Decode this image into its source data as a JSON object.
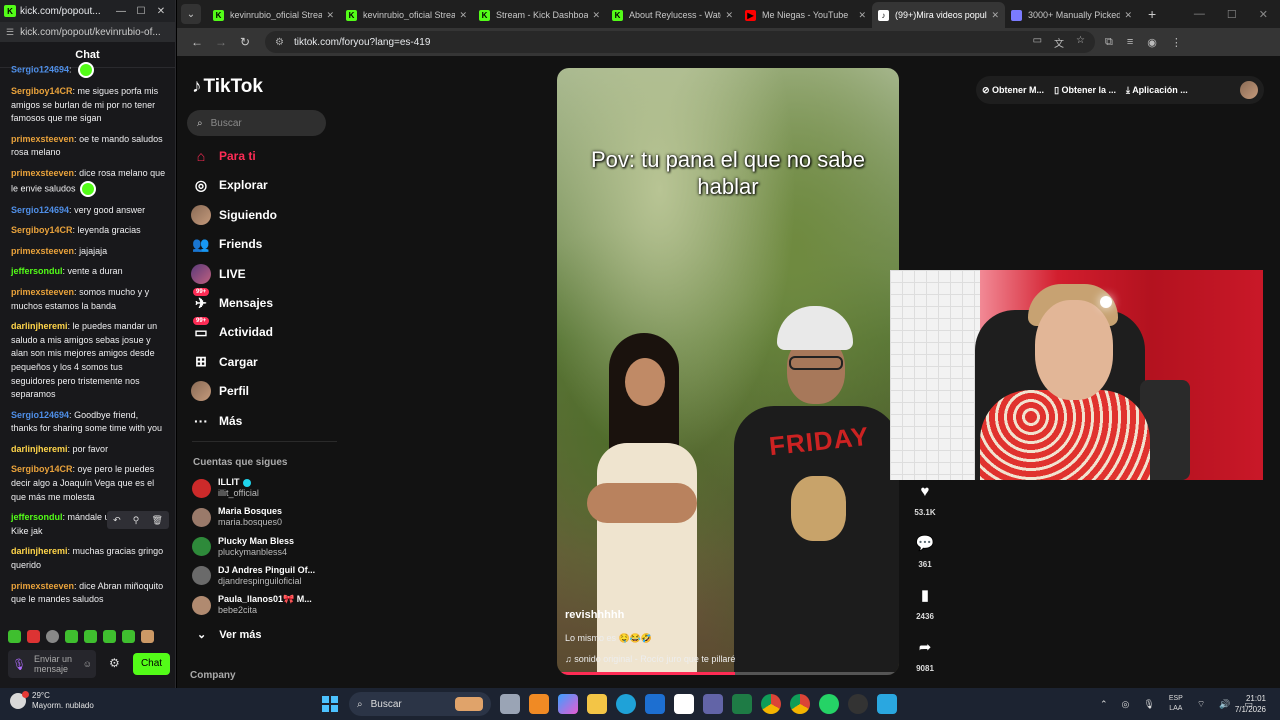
{
  "chat_window": {
    "title": "kick.com/popout...",
    "url": "kick.com/popout/kevinrubio-of...",
    "header": "Chat",
    "messages": [
      {
        "user": "Sergio124694",
        "text": "",
        "color": "blue",
        "emote": true
      },
      {
        "user": "Sergiboy14CR",
        "text": "me sigues porfa mis amigos se burlan de mi por no tener famosos que me sigan",
        "color": "orange"
      },
      {
        "user": "primexsteeven",
        "text": "oe te mando saludos rosa melano",
        "color": "orange"
      },
      {
        "user": "primexsteeven",
        "text": "dice rosa melano que le envie saludos",
        "color": "orange",
        "emote": true
      },
      {
        "user": "Sergio124694",
        "text": "very good answer",
        "color": "blue"
      },
      {
        "user": "Sergiboy14CR",
        "text": "leyenda gracias",
        "color": "orange"
      },
      {
        "user": "primexsteeven",
        "text": "jajajaja",
        "color": "orange"
      },
      {
        "user": "jeffersondul",
        "text": "vente a duran",
        "color": "green"
      },
      {
        "user": "primexsteeven",
        "text": "somos mucho y y muchos estamos la banda",
        "color": "orange"
      },
      {
        "user": "darlinjheremi",
        "text": "le puedes mandar un saludo a mis amigos sebas josue y alan son mis mejores amigos desde pequeños y los 4 somos tus seguidores pero tristemente nos separamos",
        "color": "yellow"
      },
      {
        "user": "Sergio124694",
        "text": "Goodbye friend, thanks for sharing some time with you",
        "color": "blue"
      },
      {
        "user": "darlinjheremi",
        "text": "por favor",
        "color": "yellow"
      },
      {
        "user": "Sergiboy14CR",
        "text": "oye pero le puedes decir algo a Joaquín Vega que es el que más me molesta",
        "color": "orange"
      },
      {
        "user": "jeffersondul",
        "text": "mándale un saludo a Kike jak",
        "color": "green"
      },
      {
        "user": "darlinjheremi",
        "text": "muchas gracias gringo querido",
        "color": "yellow"
      },
      {
        "user": "primexsteeven",
        "text": "dice Abran miñoquito que le mandes saludos",
        "color": "orange"
      }
    ],
    "input_placeholder": "Enviar un mensaje",
    "send_label": "Chat"
  },
  "browser": {
    "tabs": [
      {
        "title": "kevinrubio_oficial Stream",
        "icon": "kick",
        "active": false
      },
      {
        "title": "kevinrubio_oficial Stream",
        "icon": "kick",
        "active": false
      },
      {
        "title": "Stream - Kick Dashboard",
        "icon": "kick",
        "active": false
      },
      {
        "title": "About Reylucess - Watch",
        "icon": "kick",
        "active": false
      },
      {
        "title": "Me Niegas - YouTube",
        "icon": "youtube",
        "active": false
      },
      {
        "title": "(99+)Mira videos popul...",
        "icon": "tiktok",
        "active": true
      },
      {
        "title": "3000+ Manually Picked",
        "icon": "generic",
        "active": false
      }
    ],
    "url": "tiktok.com/foryou?lang=es-419"
  },
  "tiktok": {
    "logo": "TikTok",
    "search_placeholder": "Buscar",
    "nav": [
      {
        "label": "Para ti",
        "icon": "home-icon",
        "active": true
      },
      {
        "label": "Explorar",
        "icon": "compass-icon"
      },
      {
        "label": "Siguiendo",
        "icon": "following-avatar-icon"
      },
      {
        "label": "Friends",
        "icon": "friends-icon"
      },
      {
        "label": "LIVE",
        "icon": "live-icon"
      },
      {
        "label": "Mensajes",
        "icon": "messages-icon",
        "badge": "99+"
      },
      {
        "label": "Actividad",
        "icon": "activity-icon",
        "badge": "99+"
      },
      {
        "label": "Cargar",
        "icon": "upload-icon"
      },
      {
        "label": "Perfil",
        "icon": "profile-avatar-icon"
      },
      {
        "label": "Más",
        "icon": "more-icon"
      }
    ],
    "following_title": "Cuentas que sigues",
    "following": [
      {
        "name": "ILLIT",
        "handle": "illit_official",
        "verified": true
      },
      {
        "name": "Maria Bosques",
        "handle": "maria.bosques0"
      },
      {
        "name": "Plucky Man Bless",
        "handle": "pluckymanbless4"
      },
      {
        "name": "DJ Andres Pinguil Of...",
        "handle": "djandrespinguiloficial"
      },
      {
        "name": "Paula_llanos01🎀 M...",
        "handle": "bebe2cita"
      }
    ],
    "see_more": "Ver más",
    "company": "Company",
    "top_buttons": [
      "Obtener M...",
      "Obtener la ...",
      "Aplicación ..."
    ],
    "video": {
      "caption": "Pov: tu pana el que no sabe hablar",
      "username": "revishhhhh",
      "description": "Lo mismo es 🤤😂🤣",
      "sound": "sonido original - Rocío juro que te pillaré",
      "shirt_text": "FRIDAY",
      "progress": 0.52
    },
    "actions": {
      "likes": "53.1K",
      "comments": "361",
      "saves": "2436",
      "shares": "9081"
    }
  },
  "taskbar": {
    "weather_temp": "29°C",
    "weather_desc": "Mayorm. nublado",
    "search": "Buscar",
    "lang_top": "ESP",
    "lang_bottom": "LAA",
    "time": "21:01",
    "date": "7/1/2026"
  }
}
